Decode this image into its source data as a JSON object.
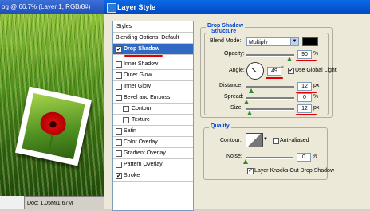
{
  "document": {
    "title": "og @ 66.7% (Layer 1, RGB/8#)",
    "status": "Doc: 1.05M/1.67M"
  },
  "dialog": {
    "title": "Layer Style"
  },
  "styles": {
    "header": "Styles",
    "items": [
      {
        "label": "Blending Options: Default",
        "has_checkbox": false,
        "checked": false,
        "indent": false
      },
      {
        "label": "Drop Shadow",
        "has_checkbox": true,
        "checked": true,
        "indent": false,
        "selected": true
      },
      {
        "label": "Inner Shadow",
        "has_checkbox": true,
        "checked": false,
        "indent": false
      },
      {
        "label": "Outer Glow",
        "has_checkbox": true,
        "checked": false,
        "indent": false
      },
      {
        "label": "Inner Glow",
        "has_checkbox": true,
        "checked": false,
        "indent": false
      },
      {
        "label": "Bevel and Emboss",
        "has_checkbox": true,
        "checked": false,
        "indent": false
      },
      {
        "label": "Contour",
        "has_checkbox": true,
        "checked": false,
        "indent": true
      },
      {
        "label": "Texture",
        "has_checkbox": true,
        "checked": false,
        "indent": true
      },
      {
        "label": "Satin",
        "has_checkbox": true,
        "checked": false,
        "indent": false
      },
      {
        "label": "Color Overlay",
        "has_checkbox": true,
        "checked": false,
        "indent": false
      },
      {
        "label": "Gradient Overlay",
        "has_checkbox": true,
        "checked": false,
        "indent": false
      },
      {
        "label": "Pattern Overlay",
        "has_checkbox": true,
        "checked": false,
        "indent": false
      },
      {
        "label": "Stroke",
        "has_checkbox": true,
        "checked": true,
        "indent": false
      }
    ]
  },
  "drop_shadow": {
    "title": "Drop Shadow",
    "structure_title": "Structure",
    "blend_mode_label": "Blend Mode:",
    "blend_mode_value": "Multiply",
    "shadow_color": "#000000",
    "opacity_label": "Opacity:",
    "opacity_value": "90",
    "opacity_unit": "%",
    "angle_label": "Angle:",
    "angle_value": "49",
    "angle_unit": "°",
    "use_global_light_label": "Use Global Light",
    "use_global_light_checked": true,
    "distance_label": "Distance:",
    "distance_value": "12",
    "distance_unit": "px",
    "spread_label": "Spread:",
    "spread_value": "0",
    "spread_unit": "%",
    "size_label": "Size:",
    "size_value": "12",
    "size_unit": "px"
  },
  "quality": {
    "title": "Quality",
    "contour_label": "Contour:",
    "anti_aliased_label": "Anti-aliased",
    "anti_aliased_checked": false,
    "noise_label": "Noise:",
    "noise_value": "0",
    "noise_unit": "%",
    "knockout_label": "Layer Knocks Out Drop Shadow",
    "knockout_checked": true
  },
  "colors": {
    "selection": "#316ac5",
    "annotation": "#e00000",
    "group_title": "#0046d5"
  }
}
